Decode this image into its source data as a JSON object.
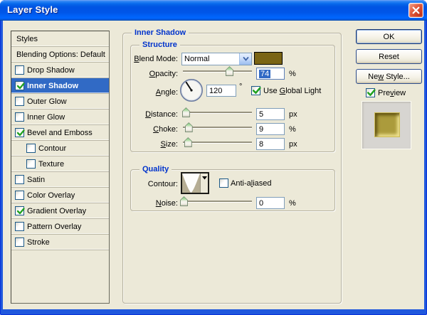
{
  "window": {
    "title": "Layer Style"
  },
  "colors": {
    "selection": "#316AC5",
    "group_title_blue": "#0033CC",
    "check_green": "#21A121",
    "swatch": "#7A6414"
  },
  "sidebar": {
    "header": "Styles",
    "blending": "Blending Options: Default",
    "items": [
      {
        "label": "Drop Shadow",
        "checked": false,
        "selected": false,
        "indent": false
      },
      {
        "label": "Inner Shadow",
        "checked": true,
        "selected": true,
        "indent": false
      },
      {
        "label": "Outer Glow",
        "checked": false,
        "selected": false,
        "indent": false
      },
      {
        "label": "Inner Glow",
        "checked": false,
        "selected": false,
        "indent": false
      },
      {
        "label": "Bevel and Emboss",
        "checked": true,
        "selected": false,
        "indent": false
      },
      {
        "label": "Contour",
        "checked": false,
        "selected": false,
        "indent": true
      },
      {
        "label": "Texture",
        "checked": false,
        "selected": false,
        "indent": true
      },
      {
        "label": "Satin",
        "checked": false,
        "selected": false,
        "indent": false
      },
      {
        "label": "Color Overlay",
        "checked": false,
        "selected": false,
        "indent": false
      },
      {
        "label": "Gradient Overlay",
        "checked": true,
        "selected": false,
        "indent": false
      },
      {
        "label": "Pattern Overlay",
        "checked": false,
        "selected": false,
        "indent": false
      },
      {
        "label": "Stroke",
        "checked": false,
        "selected": false,
        "indent": false
      }
    ]
  },
  "panel": {
    "title": "Inner Shadow",
    "structure": {
      "title": "Structure",
      "blend_mode_label": "[B]lend Mode:",
      "blend_mode_value": "Normal",
      "swatch_color": "#7A6414",
      "opacity_label": "[O]pacity:",
      "opacity_value": "74",
      "opacity_unit": "%",
      "opacity_thumb_pct": 67,
      "angle_label": "[A]ngle:",
      "angle_value": "120",
      "angle_unit": "°",
      "use_global_light_label": "Use [G]lobal Light",
      "use_global_light_checked": true,
      "distance": {
        "label": "[D]istance:",
        "value": "5",
        "unit": "px",
        "thumb_pct": 4
      },
      "choke": {
        "label": "[C]hoke:",
        "value": "9",
        "unit": "%",
        "thumb_pct": 8
      },
      "size": {
        "label": "[S]ize:",
        "value": "8",
        "unit": "px",
        "thumb_pct": 7
      }
    },
    "quality": {
      "title": "Quality",
      "contour_label": "Contour:",
      "anti_aliased_label": "Anti-a[l]iased",
      "anti_aliased_checked": false,
      "noise": {
        "label": "[N]oise:",
        "value": "0",
        "unit": "%",
        "thumb_pct": 1
      }
    }
  },
  "actions": {
    "ok": "OK",
    "reset": "Reset",
    "new_style": "Ne[w] Style...",
    "preview_label": "Pre[v]iew",
    "preview_checked": true
  }
}
